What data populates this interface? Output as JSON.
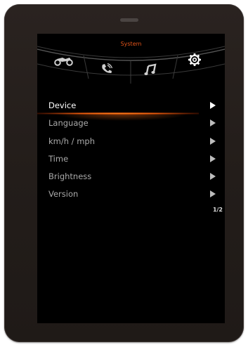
{
  "header": {
    "title": "System"
  },
  "tabs": [
    {
      "icon": "motorcycle-icon"
    },
    {
      "icon": "phone-icon"
    },
    {
      "icon": "music-icon"
    },
    {
      "icon": "gear-icon",
      "active": true
    }
  ],
  "menu": {
    "items": [
      {
        "label": "Device",
        "selected": true
      },
      {
        "label": "Language"
      },
      {
        "label": "km/h / mph"
      },
      {
        "label": "Time"
      },
      {
        "label": "Brightness"
      },
      {
        "label": "Version"
      }
    ]
  },
  "pagination": {
    "text": "1/2"
  },
  "colors": {
    "accent": "#e2541a",
    "screen_bg": "#000000",
    "bezel": "#231d1a"
  }
}
